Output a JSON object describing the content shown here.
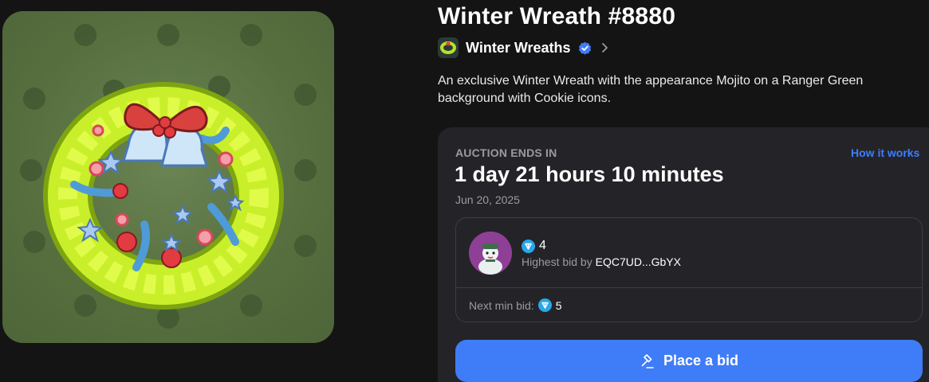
{
  "nft": {
    "title": "Winter Wreath #8880",
    "collection_name": "Winter Wreaths",
    "description": "An exclusive Winter Wreath with the appearance Mojito on a Ranger Green background with Cookie icons."
  },
  "auction": {
    "ends_label": "AUCTION ENDS IN",
    "how_it_works": "How it works",
    "countdown": "1 day 21 hours 10 minutes",
    "end_date": "Jun 20, 2025",
    "highest_bid_amount": "4",
    "highest_bid_prefix": "Highest bid by",
    "highest_bid_address": "EQC7UD...GbYX",
    "next_min_label": "Next min bid:",
    "next_min_amount": "5",
    "place_bid_label": "Place a bid"
  },
  "icons": {
    "verified": "verified-badge-icon",
    "chevron": "chevron-right-icon",
    "currency": "ton-icon",
    "bid_button": "gavel-icon"
  },
  "colors": {
    "background": "#141414",
    "card": "#242428",
    "accent": "#3f7cf7",
    "link": "#3c7dff",
    "nft_background": "#58703f",
    "muted_text": "#9a9aa0"
  }
}
